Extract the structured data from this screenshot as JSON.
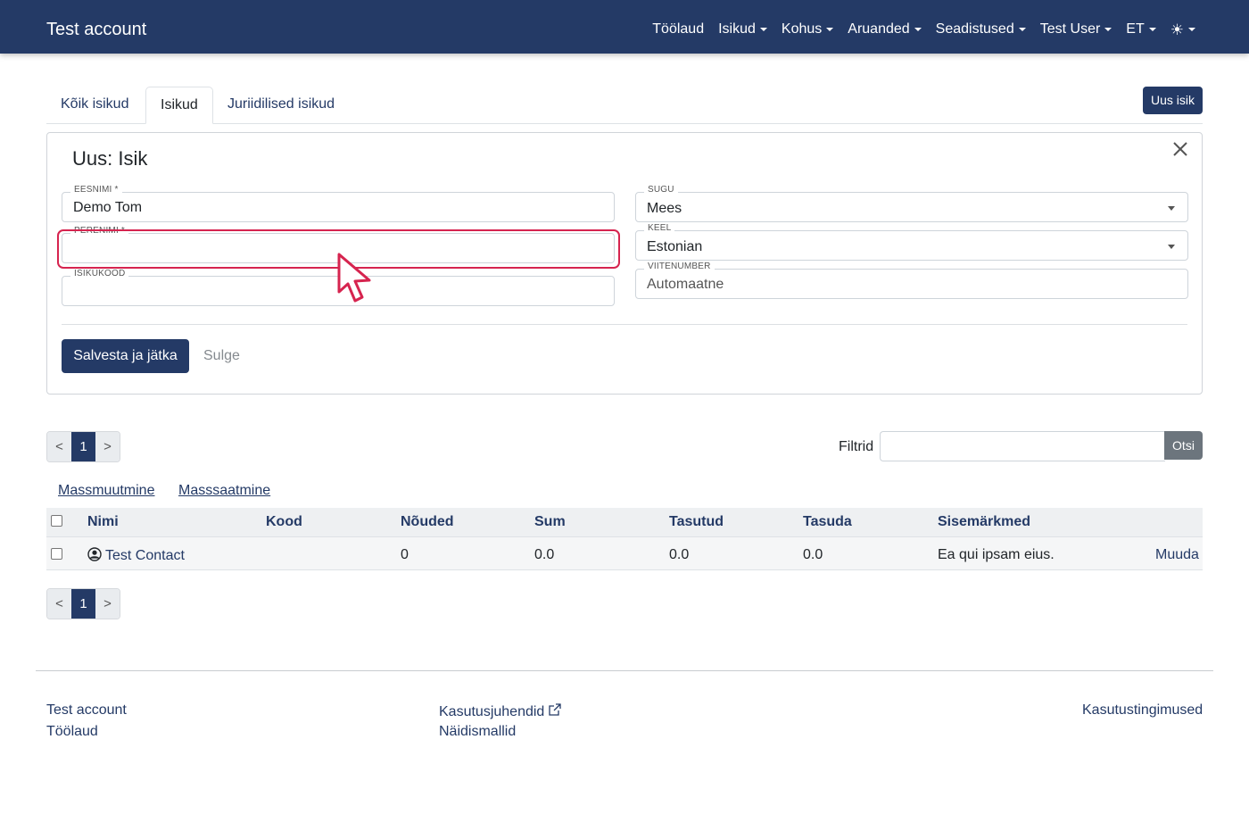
{
  "navbar": {
    "brand": "Test account",
    "items": [
      {
        "label": "Töölaud",
        "dropdown": false
      },
      {
        "label": "Isikud",
        "dropdown": true
      },
      {
        "label": "Kohus",
        "dropdown": true
      },
      {
        "label": "Aruanded",
        "dropdown": true
      },
      {
        "label": "Seadistused",
        "dropdown": true
      },
      {
        "label": "Test User",
        "dropdown": true
      },
      {
        "label": "ET",
        "dropdown": true
      }
    ],
    "theme_icon": "☀"
  },
  "tabs": [
    {
      "label": "Kõik isikud",
      "active": false
    },
    {
      "label": "Isikud",
      "active": true
    },
    {
      "label": "Juriidilised isikud",
      "active": false
    }
  ],
  "new_button": "Uus isik",
  "form": {
    "title": "Uus: Isik",
    "first_name": {
      "label": "EESNIMI *",
      "value": "Demo Tom"
    },
    "last_name": {
      "label": "PERENIMI *",
      "value": ""
    },
    "id_code": {
      "label": "ISIKUKOOD",
      "value": ""
    },
    "gender": {
      "label": "SUGU",
      "value": "Mees"
    },
    "language": {
      "label": "KEEL",
      "value": "Estonian"
    },
    "reference": {
      "label": "VIITENUMBER",
      "value": "Automaatne"
    },
    "save_label": "Salvesta ja jätka",
    "close_label": "Sulge"
  },
  "pagination": {
    "prev": "<",
    "current": "1",
    "next": ">"
  },
  "filter": {
    "label": "Filtrid",
    "value": "",
    "button": "Otsi"
  },
  "bulk": {
    "edit": "Massmuutmine",
    "send": "Masssaatmine"
  },
  "table": {
    "headers": [
      "Nimi",
      "Kood",
      "Nõuded",
      "Sum",
      "Tasutud",
      "Tasuda",
      "Sisemärkmed"
    ],
    "rows": [
      {
        "name": "Test Contact",
        "code": "",
        "claims": "0",
        "sum": "0.0",
        "paid": "0.0",
        "due": "0.0",
        "notes": "Ea qui ipsam eius.",
        "action": "Muuda"
      }
    ]
  },
  "footer": {
    "col1": [
      "Test account",
      "Töölaud"
    ],
    "col2": [
      "Kasutusjuhendid",
      "Näidismallid"
    ],
    "col3": [
      "Kasutustingimused"
    ]
  },
  "colors": {
    "primary": "#243a66",
    "focus": "#d6244f",
    "secondary": "#6c757d"
  }
}
